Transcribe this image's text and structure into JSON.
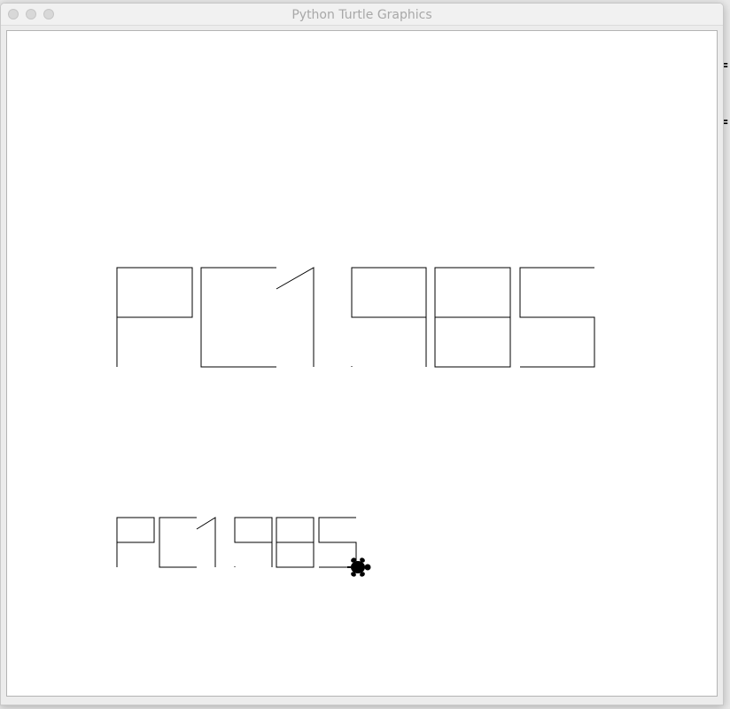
{
  "window": {
    "title": "Python Turtle Graphics"
  },
  "canvas": {
    "large_text": "PC1985",
    "small_text": "PC1985",
    "pen_color": "#000000",
    "background_color": "#ffffff",
    "turtle_icon": "turtle-cursor-icon"
  }
}
